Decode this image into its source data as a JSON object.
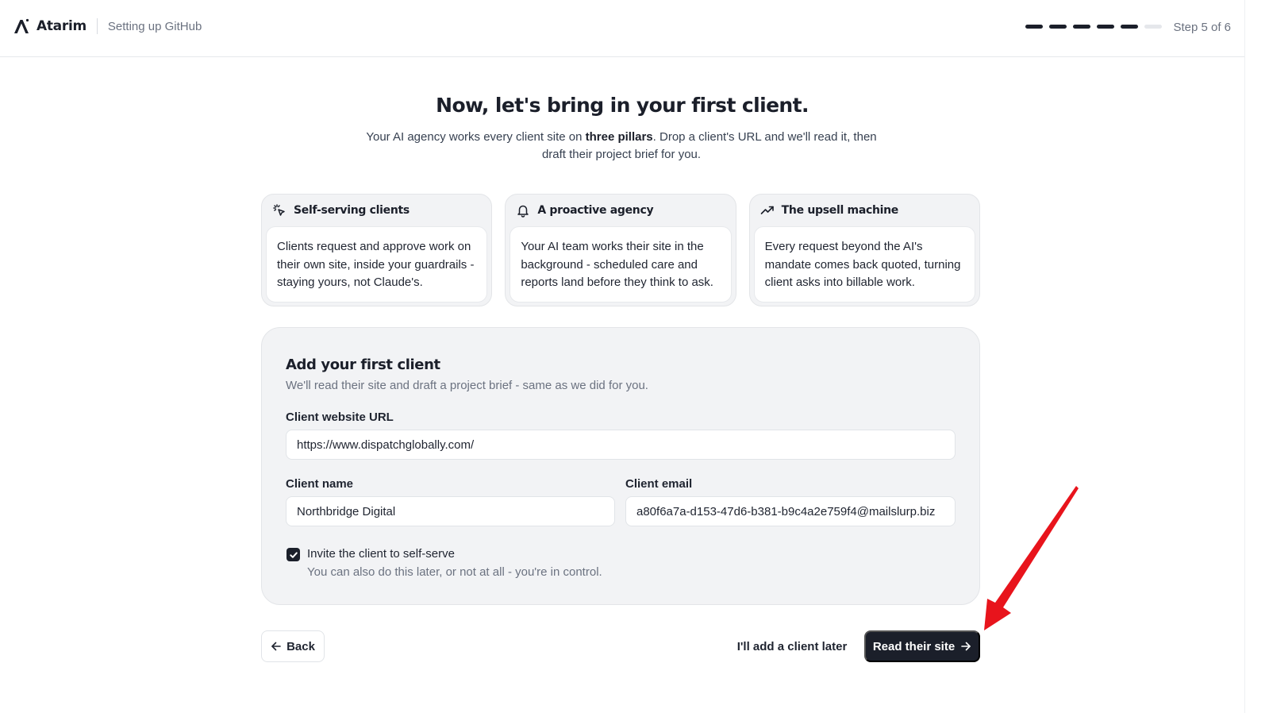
{
  "header": {
    "brand_name": "Atarim",
    "subtitle": "Setting up GitHub",
    "progress": {
      "total_steps": 6,
      "completed_steps": 5
    },
    "step_label": "Step 5 of 6"
  },
  "hero": {
    "title": "Now, let's bring in your first client.",
    "desc_before": "Your AI agency works every client site on ",
    "desc_bold": "three pillars",
    "desc_after": ". Drop a client's URL and we'll read it, then draft their project brief for you."
  },
  "pillars": [
    {
      "icon": "sparkle-cursor-icon",
      "title": "Self-serving clients",
      "body": "Clients request and approve work on their own site, inside your guardrails - staying yours, not Claude's."
    },
    {
      "icon": "bell-icon",
      "title": "A proactive agency",
      "body": "Your AI team works their site in the background - scheduled care and reports land before they think to ask."
    },
    {
      "icon": "trending-up-icon",
      "title": "The upsell machine",
      "body": "Every request beyond the AI's mandate comes back quoted, turning client asks into billable work."
    }
  ],
  "form": {
    "title": "Add your first client",
    "subtitle": "We'll read their site and draft a project brief - same as we did for you.",
    "url_label": "Client website URL",
    "url_value": "https://www.dispatchglobally.com/",
    "name_label": "Client name",
    "name_value": "Northbridge Digital",
    "email_label": "Client email",
    "email_value": "a80f6a7a-d153-47d6-b381-b9c4a2e759f4@mailslurp.biz",
    "invite_checked": true,
    "invite_label": "Invite the client to self-serve",
    "invite_help": "You can also do this later, or not at all - you're in control."
  },
  "footer": {
    "back_label": "Back",
    "later_label": "I'll add a client later",
    "primary_label": "Read their site"
  },
  "colors": {
    "primary": "#1b1f2a",
    "annotation_arrow": "#e8141c"
  }
}
